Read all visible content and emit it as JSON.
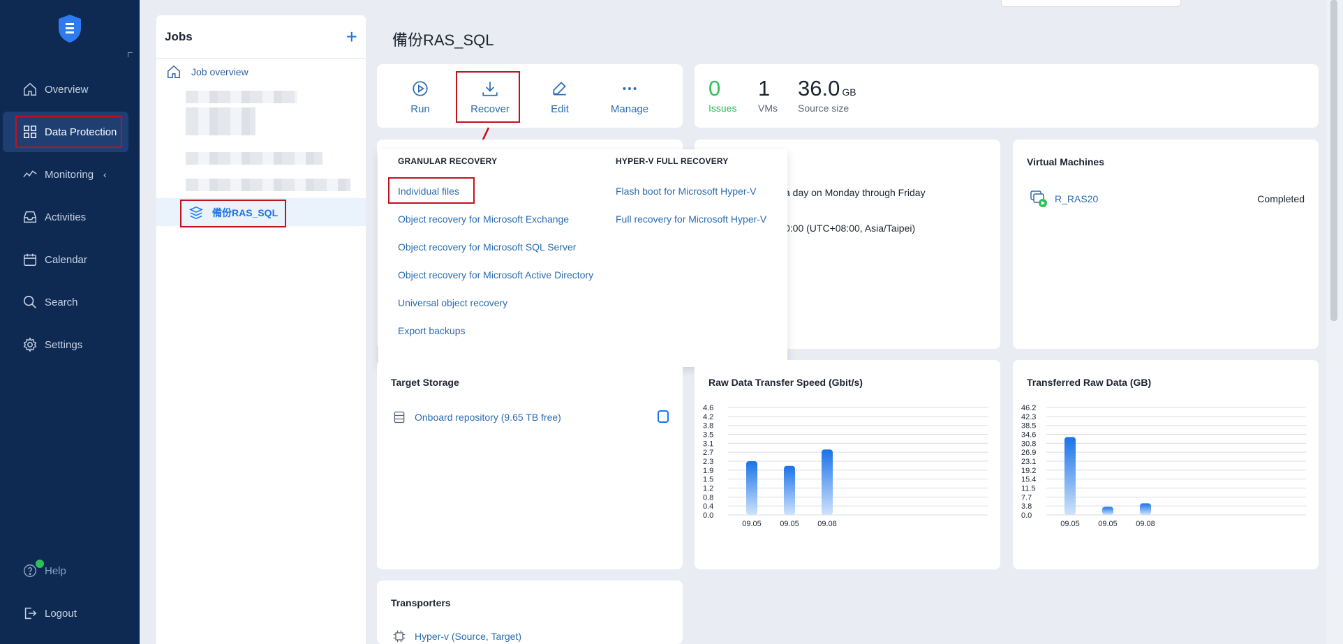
{
  "sidebar": {
    "items": [
      {
        "label": "Overview",
        "icon": "home-icon"
      },
      {
        "label": "Data Protection",
        "icon": "grid-icon",
        "active": true
      },
      {
        "label": "Monitoring",
        "icon": "pulse-icon",
        "chevron": "‹"
      },
      {
        "label": "Activities",
        "icon": "inbox-icon"
      },
      {
        "label": "Calendar",
        "icon": "calendar-icon"
      },
      {
        "label": "Search",
        "icon": "search-icon"
      },
      {
        "label": "Settings",
        "icon": "gear-icon"
      }
    ],
    "help": "Help",
    "logout": "Logout"
  },
  "jobs": {
    "title": "Jobs",
    "add": "+",
    "overview": "Job overview",
    "selected_job": "備份RAS_SQL"
  },
  "page": {
    "title": "備份RAS_SQL"
  },
  "actions": {
    "run": "Run",
    "recover": "Recover",
    "edit": "Edit",
    "manage": "Manage"
  },
  "stats": {
    "issues_value": "0",
    "issues_label": "Issues",
    "vms_value": "1",
    "vms_label": "VMs",
    "size_value": "36.0",
    "size_unit": "GB",
    "size_label": "Source size"
  },
  "schedule": {
    "line1": "a day on Monday through Friday",
    "line2": "0:00 (UTC+08:00, Asia/Taipei)"
  },
  "dropdown": {
    "granular_head": "GRANULAR RECOVERY",
    "granular_items": [
      "Individual files",
      "Object recovery for Microsoft Exchange",
      "Object recovery for Microsoft SQL Server",
      "Object recovery for Microsoft Active Directory",
      "Universal object recovery",
      "Export backups"
    ],
    "hyperv_head": "HYPER-V FULL RECOVERY",
    "hyperv_items": [
      "Flash boot for Microsoft Hyper-V",
      "Full recovery for Microsoft Hyper-V"
    ]
  },
  "virtual_machines": {
    "title": "Virtual Machines",
    "vm_name": "R_RAS20",
    "vm_status": "Completed"
  },
  "target_storage": {
    "title": "Target Storage",
    "repo": "Onboard repository (9.65 TB free)"
  },
  "transporters": {
    "title": "Transporters",
    "item": "Hyper-v (Source, Target)"
  },
  "colors": {
    "sidebar_bg": "#0f2a52",
    "accent": "#1a73e8",
    "highlight_box": "#c0121d",
    "issues_green": "#2fbf5a"
  },
  "chart_data": [
    {
      "type": "bar",
      "title": "Raw Data Transfer Speed (Gbit/s)",
      "categories": [
        "09.05",
        "09.05",
        "09.08"
      ],
      "values": [
        2.3,
        2.1,
        2.8
      ],
      "y_ticks": [
        "4.6",
        "4.2",
        "3.8",
        "3.5",
        "3.1",
        "2.7",
        "2.3",
        "1.9",
        "1.5",
        "1.2",
        "0.8",
        "0.4",
        "0.0"
      ],
      "ylim": [
        0,
        4.6
      ],
      "grid": true
    },
    {
      "type": "bar",
      "title": "Transferred Raw Data (GB)",
      "categories": [
        "09.05",
        "09.05",
        "09.08"
      ],
      "values": [
        33.5,
        3.5,
        5.0
      ],
      "y_ticks": [
        "46.2",
        "42.3",
        "38.5",
        "34.6",
        "30.8",
        "26.9",
        "23.1",
        "19.2",
        "15.4",
        "11.5",
        "7.7",
        "3.8",
        "0.0"
      ],
      "ylim": [
        0,
        46.2
      ],
      "grid": true
    }
  ]
}
